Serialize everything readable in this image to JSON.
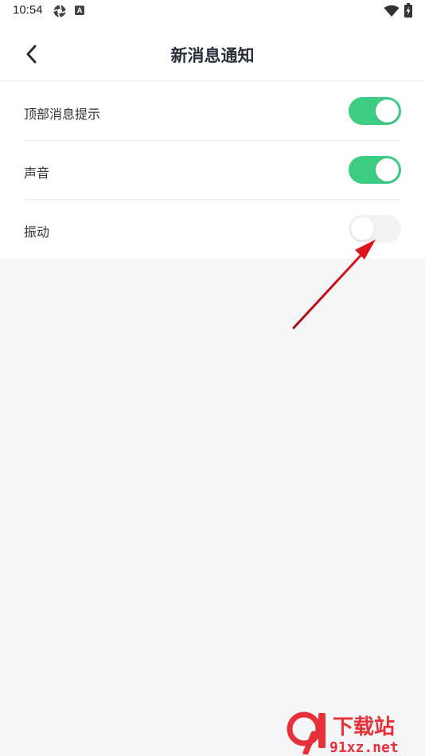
{
  "status_bar": {
    "time": "10:54",
    "icons": [
      "aperture-icon",
      "a-badge-icon",
      "wifi-icon",
      "battery-charging-icon"
    ]
  },
  "header": {
    "back_icon": "chevron-left-icon",
    "title": "新消息通知"
  },
  "settings": [
    {
      "label": "顶部消息提示",
      "enabled": true
    },
    {
      "label": "声音",
      "enabled": true
    },
    {
      "label": "振动",
      "enabled": false
    }
  ],
  "colors": {
    "toggle_on": "#3ccc82",
    "toggle_off": "#f2f2f2",
    "background": "#f5f6f8",
    "annotation_arrow": "#d9141c"
  },
  "watermark": {
    "logo_text": "9",
    "title": "下载站",
    "site": "91xz.net"
  }
}
